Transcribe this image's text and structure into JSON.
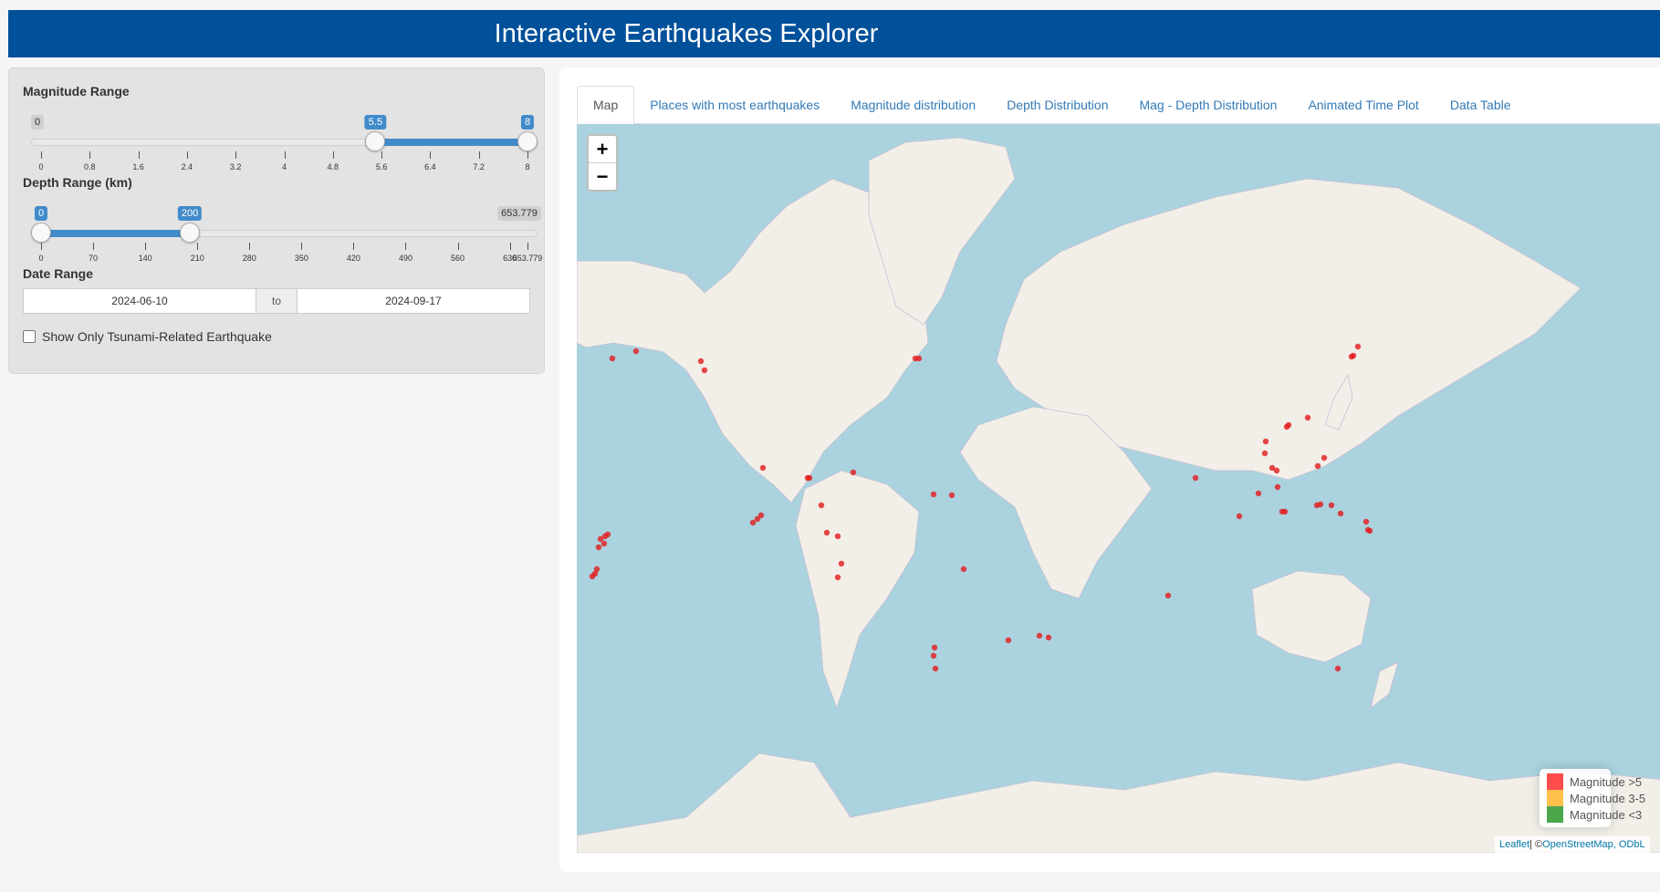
{
  "app": {
    "title": "Interactive Earthquakes Explorer"
  },
  "sidebar": {
    "magnitude": {
      "label": "Magnitude Range",
      "min_label": "0",
      "low_label": "5.5",
      "high_label": "8",
      "min": 0,
      "max": 8,
      "low": 5.5,
      "high": 8,
      "ticks": [
        "0",
        "0.8",
        "1.6",
        "2.4",
        "3.2",
        "4",
        "4.8",
        "5.6",
        "6.4",
        "7.2",
        "8"
      ]
    },
    "depth": {
      "label": "Depth Range (km)",
      "low_label": "0",
      "high_label": "200",
      "max_label": "653.779",
      "min": 0,
      "max": 653.779,
      "low": 0,
      "high": 200,
      "ticks": [
        "0",
        "70",
        "140",
        "210",
        "280",
        "350",
        "420",
        "490",
        "560",
        "630",
        "653.779"
      ],
      "tick_values": [
        0,
        70,
        140,
        210,
        280,
        350,
        420,
        490,
        560,
        630,
        653.779
      ]
    },
    "date": {
      "label": "Date Range",
      "start": "2024-06-10",
      "separator": "to",
      "end": "2024-09-17"
    },
    "tsunami": {
      "label": "Show Only Tsunami-Related Earthquake",
      "checked": false
    }
  },
  "tabs": [
    {
      "label": "Map",
      "active": true
    },
    {
      "label": "Places with most earthquakes",
      "active": false
    },
    {
      "label": "Magnitude distribution",
      "active": false
    },
    {
      "label": "Depth Distribution",
      "active": false
    },
    {
      "label": "Mag - Depth Distribution",
      "active": false
    },
    {
      "label": "Animated Time Plot",
      "active": false
    },
    {
      "label": "Data Table",
      "active": false
    }
  ],
  "map": {
    "zoom_in": "+",
    "zoom_out": "−",
    "legend": [
      {
        "label": "Magnitude >5",
        "color": "#ff0000"
      },
      {
        "label": "Magnitude 3-5",
        "color": "#ffa500"
      },
      {
        "label": "Magnitude <3",
        "color": "#008000"
      }
    ],
    "attribution": {
      "leaflet": "Leaflet",
      "sep": " | © ",
      "osm": "OpenStreetMap, ODbL"
    },
    "marker_color": "#e41a1c",
    "land_color": "#f2efe9",
    "water_color": "#aad3df"
  }
}
